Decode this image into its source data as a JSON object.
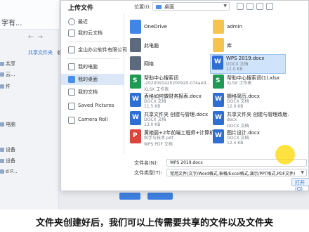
{
  "background_app": {
    "title": "字有...",
    "tabs": [
      "共享文件夹",
      "收"
    ],
    "side_items": [
      "共享",
      "云...",
      "件",
      "电脑",
      "设备",
      "设备",
      "d P..."
    ],
    "subtitle": "文件夹创建好后，我们可以上传需要共享的文件以及文件夹"
  },
  "dialog": {
    "title": "上传文件",
    "location_label": "位置(I):",
    "location_value": "桌面",
    "sidebar": [
      {
        "label": "最近",
        "icon": "clock-icon"
      },
      {
        "label": "我的云文档",
        "icon": "cloud-doc-icon"
      },
      {
        "label": "金山办公软件有限公司",
        "icon": "company-icon"
      },
      {
        "label": "我的电脑",
        "icon": "computer-icon"
      },
      {
        "label": "我的桌面",
        "icon": "desktop-icon",
        "active": true
      },
      {
        "label": "我的文档",
        "icon": "documents-icon"
      },
      {
        "label": "Saved Pictures",
        "icon": "folder-icon"
      },
      {
        "label": "Camera Roll",
        "icon": "folder-icon"
      }
    ],
    "files": [
      {
        "name": "OneDrive",
        "meta": "",
        "meta2": "",
        "type": "cloud"
      },
      {
        "name": "admin",
        "meta": "",
        "meta2": "",
        "type": "folder"
      },
      {
        "name": "此电脑",
        "meta": "",
        "meta2": "",
        "type": "pc"
      },
      {
        "name": "库",
        "meta": "",
        "meta2": "",
        "type": "folder"
      },
      {
        "name": "网络",
        "meta": "",
        "meta2": "",
        "type": "net"
      },
      {
        "name": "WPS 2019.docx",
        "meta": "DOCX 文档",
        "meta2": "12.0 KB",
        "type": "doc",
        "selected": true
      },
      {
        "name": "帮助中心搜索词",
        "meta": "-2020091420200920-074a4d...",
        "meta2": "XLSX 工作表",
        "type": "xls"
      },
      {
        "name": "帮助中心搜索词(1).xlsx",
        "meta": "XLSX 工作表",
        "meta2": "",
        "type": "xls"
      },
      {
        "name": "表格如何做财务报表.docx",
        "meta": "DOCX 文档",
        "meta2": "11.5 KB",
        "type": "doc"
      },
      {
        "name": "栅格简历.docx",
        "meta": "DOCX 文档",
        "meta2": "12.0 KB",
        "type": "doc"
      },
      {
        "name": "共享文件夹 创建与管理.docx",
        "meta": "DOCX 文档",
        "meta2": "13.0 KB",
        "type": "doc"
      },
      {
        "name": "共享文件夹 创建与管理改版.",
        "meta": "docx",
        "meta2": "DOCX 文档",
        "type": "doc"
      },
      {
        "name": "黄艳丽+2年前端工程师+计算机",
        "meta": "科学与技术.pdf",
        "meta2": "WPS PDF 文档",
        "type": "pdf"
      },
      {
        "name": "图片设计.docx",
        "meta": "DOCX 文档",
        "meta2": "12.4 KB",
        "type": "doc"
      }
    ],
    "filename_label": "文件名(N):",
    "filename_value": "WPS 2019.docx",
    "filetype_label": "文件类型(T):",
    "filetype_value": "常用文件(文字/Word格式,表格/Excel格式,演示/PPT格式,PDF文件)",
    "open_label": "打开(O)"
  }
}
